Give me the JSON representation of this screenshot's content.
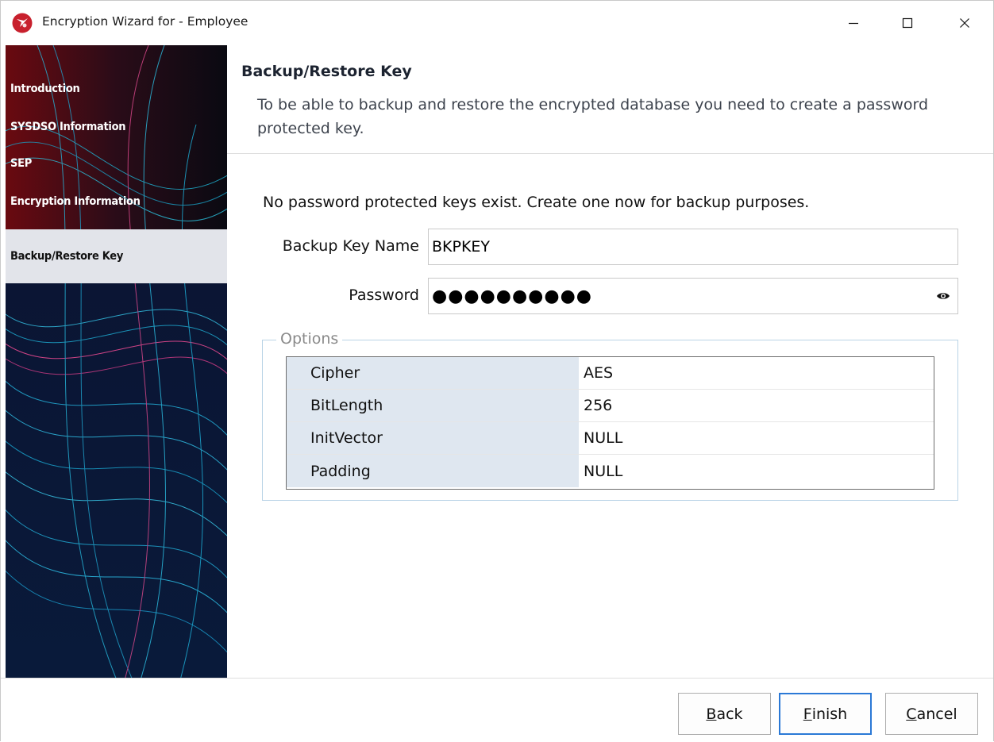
{
  "window": {
    "title": "Encryption Wizard for - Employee",
    "accent_color": "#2b79d6",
    "app_icon": "wizard-logo-icon"
  },
  "sidebar": {
    "items": [
      {
        "label": "Introduction",
        "active": false
      },
      {
        "label": "SYSDSO Information",
        "active": false
      },
      {
        "label": "SEP",
        "active": false
      },
      {
        "label": "Encryption Information",
        "active": false
      },
      {
        "label": "Backup/Restore Key",
        "active": true
      }
    ]
  },
  "header": {
    "title": "Backup/Restore Key",
    "description": "To be able to backup and restore the encrypted database you need to create a password protected key."
  },
  "form": {
    "intro": "No password protected keys exist.  Create one now for backup purposes.",
    "backup_key_label": "Backup Key Name",
    "backup_key_value": "BKPKEY",
    "password_label": "Password",
    "password_mask": "●●●●●●●●●●"
  },
  "options": {
    "legend": "Options",
    "rows": [
      {
        "key": "Cipher",
        "value": "AES"
      },
      {
        "key": "BitLength",
        "value": "256"
      },
      {
        "key": "InitVector",
        "value": "NULL"
      },
      {
        "key": "Padding",
        "value": "NULL"
      }
    ]
  },
  "footer": {
    "back": {
      "mnemonic": "B",
      "rest": "ack"
    },
    "finish": {
      "mnemonic": "F",
      "rest": "inish"
    },
    "cancel": {
      "mnemonic": "C",
      "rest": "ancel"
    }
  }
}
